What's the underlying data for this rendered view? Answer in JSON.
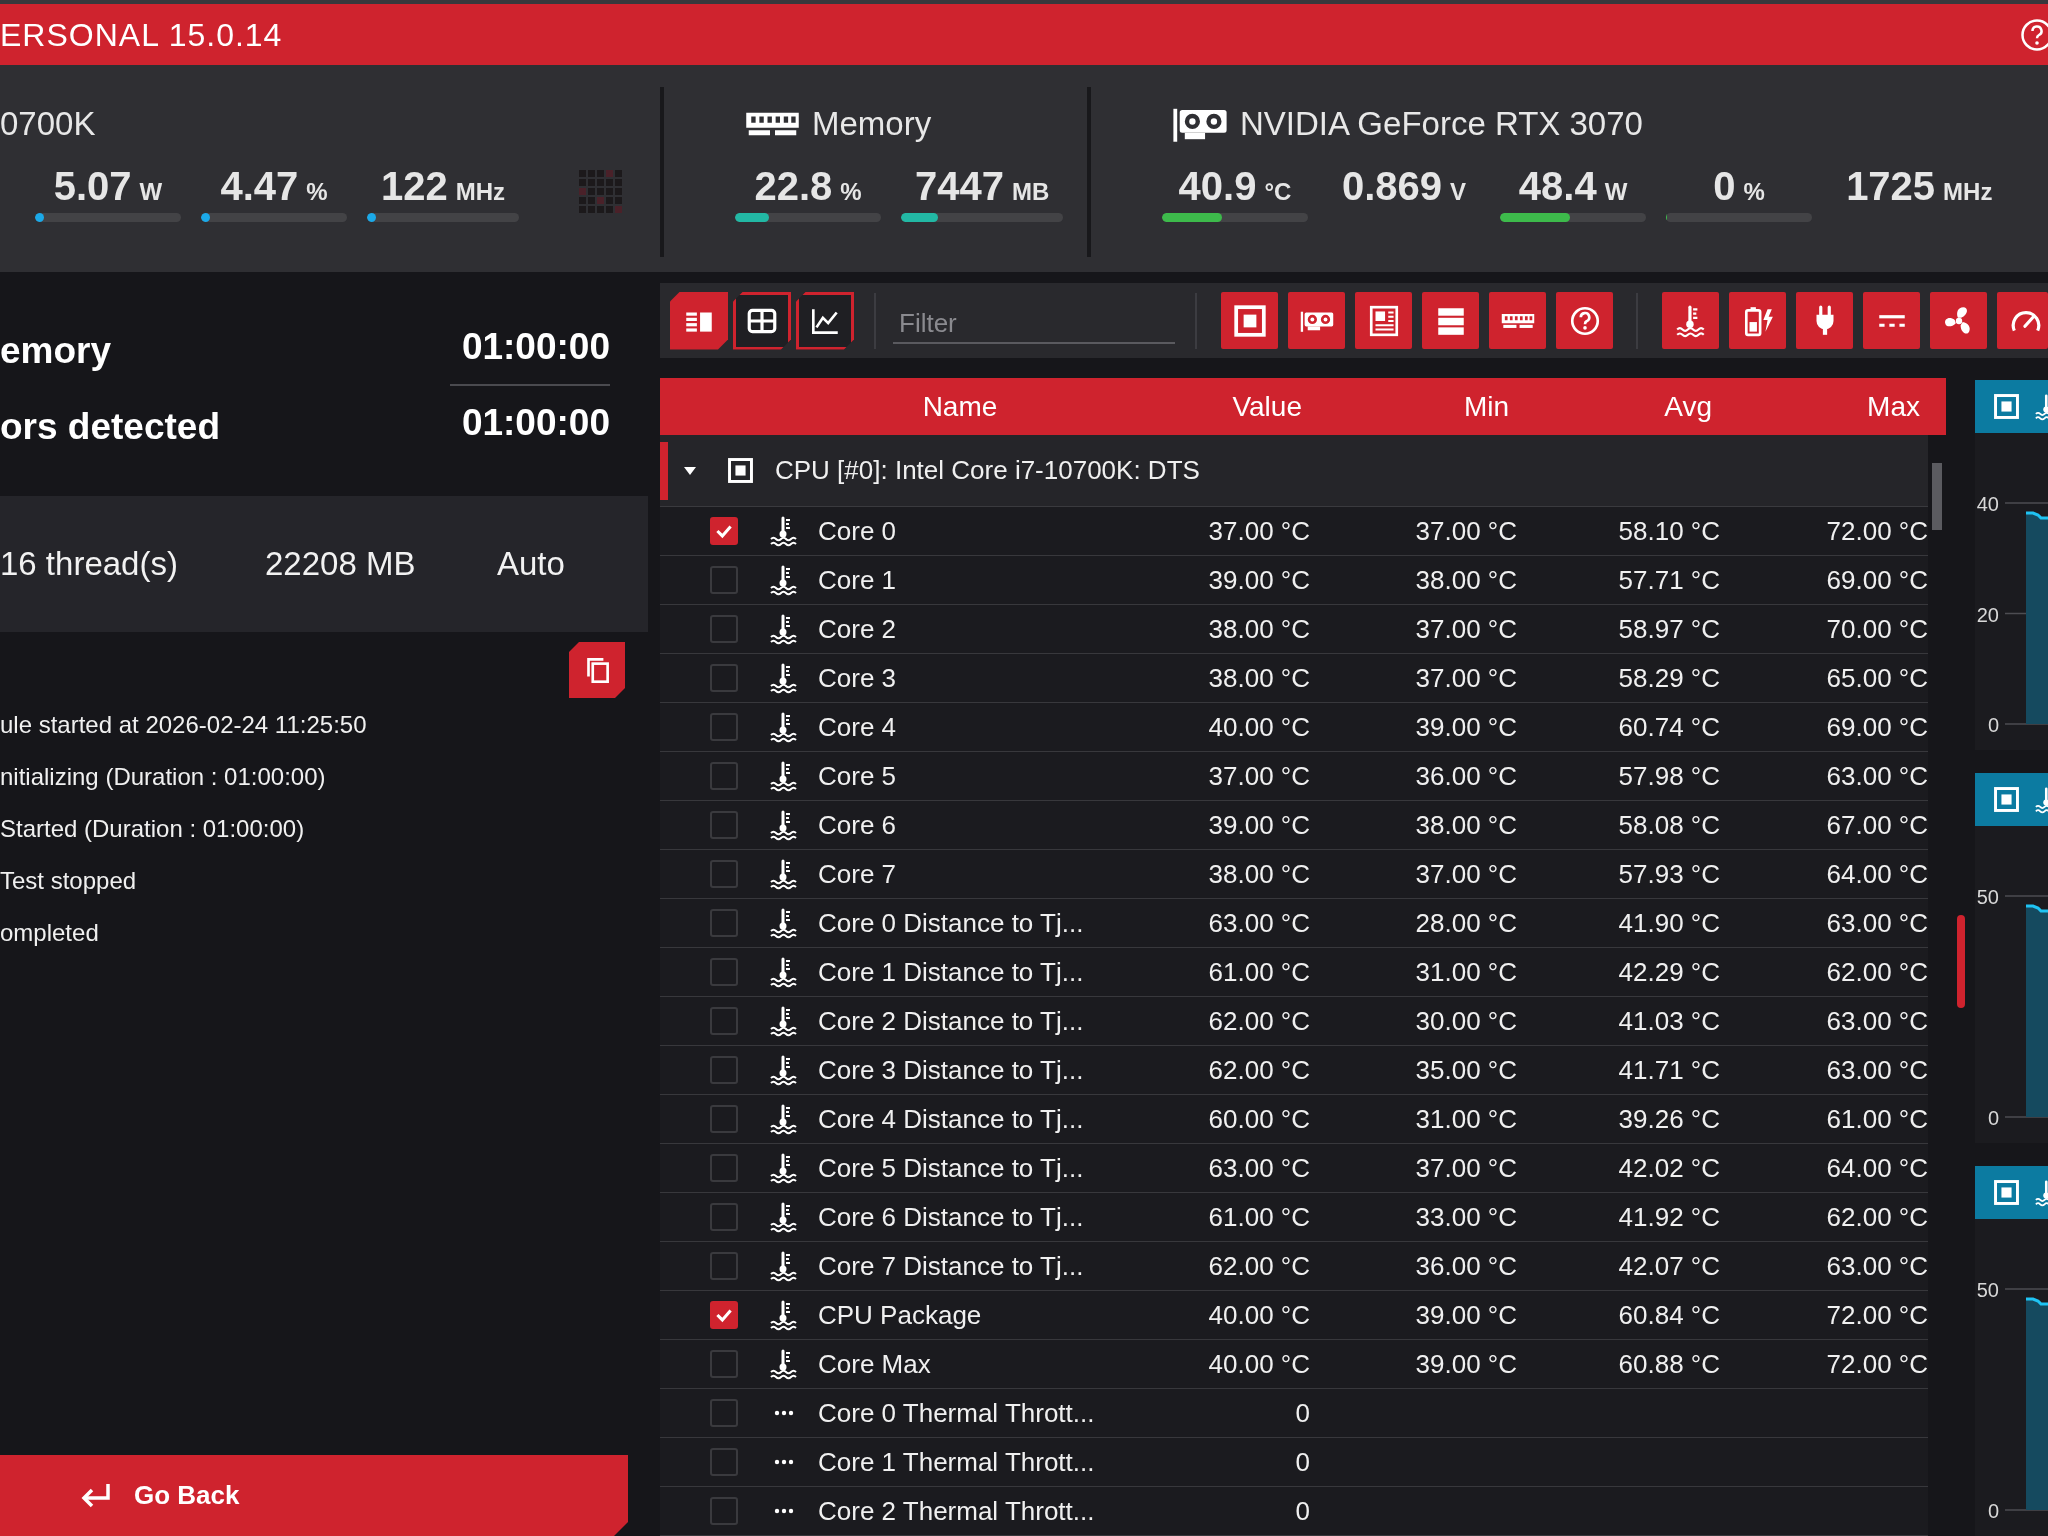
{
  "title_bar": {
    "title": "ERSONAL 15.0.14"
  },
  "hardware": [
    {
      "kind": "cpu",
      "title": "0700K",
      "stats": [
        {
          "value": "5.07",
          "unit": "W",
          "level": 0.03
        },
        {
          "value": "4.47",
          "unit": "%",
          "level": 0.04
        },
        {
          "value": "122",
          "unit": "MHz",
          "level": 0.02
        }
      ]
    },
    {
      "kind": "memory",
      "title": "Memory",
      "stats": [
        {
          "value": "22.8",
          "unit": "%",
          "level": 0.23
        },
        {
          "value": "7447",
          "unit": "MB",
          "level": 0.23
        }
      ]
    },
    {
      "kind": "gpu",
      "title": "NVIDIA GeForce RTX 3070",
      "stats": [
        {
          "value": "40.9",
          "unit": "°C",
          "level": 0.41
        },
        {
          "value": "0.869",
          "unit": "V"
        },
        {
          "value": "48.4",
          "unit": "W",
          "level": 0.48
        },
        {
          "value": "0",
          "unit": "%",
          "level": 0
        },
        {
          "value": "1725",
          "unit": "MHz"
        }
      ]
    }
  ],
  "test_results": [
    {
      "label": "emory",
      "time": "01:00:00"
    },
    {
      "label": "ors detected",
      "time": "01:00:00"
    }
  ],
  "system_info": [
    "16 thread(s)",
    "22208 MB",
    "Auto"
  ],
  "log": [
    "ule started at 2026-02-24 11:25:50",
    "nitializing (Duration : 01:00:00)",
    "Started (Duration : 01:00:00)",
    "Test stopped",
    "ompleted"
  ],
  "go_back": {
    "label": "Go Back"
  },
  "view_buttons": [
    {
      "kind": "list",
      "selected": true
    },
    {
      "kind": "table",
      "selected": false
    },
    {
      "kind": "chart",
      "selected": false
    }
  ],
  "filter": {
    "placeholder": "Filter"
  },
  "device_filters": [
    {
      "kind": "cpu",
      "selected": true
    },
    {
      "kind": "gpu",
      "selected": true
    },
    {
      "kind": "motherboard",
      "selected": true
    },
    {
      "kind": "storage",
      "selected": true
    },
    {
      "kind": "memory",
      "selected": true
    },
    {
      "kind": "other",
      "selected": true
    }
  ],
  "sensor_filters": [
    {
      "kind": "temperature",
      "selected": true
    },
    {
      "kind": "power",
      "selected": true
    },
    {
      "kind": "plug",
      "selected": true
    },
    {
      "kind": "dc",
      "selected": true
    },
    {
      "kind": "fan",
      "selected": true
    },
    {
      "kind": "gauge",
      "selected": true
    }
  ],
  "table": {
    "columns": [
      "Name",
      "Value",
      "Min",
      "Avg",
      "Max"
    ],
    "groups": [
      {
        "kind": "cpu",
        "name": "CPU [#0]: Intel Core i7-10700K: DTS",
        "expanded": true,
        "selected": true,
        "rows": [
          {
            "kind": "temperature",
            "checked": true,
            "name": "Core 0",
            "value": "37.00 °C",
            "min": "37.00 °C",
            "avg": "58.10 °C",
            "max": "72.00 °C"
          },
          {
            "kind": "temperature",
            "checked": false,
            "name": "Core 1",
            "value": "39.00 °C",
            "min": "38.00 °C",
            "avg": "57.71 °C",
            "max": "69.00 °C"
          },
          {
            "kind": "temperature",
            "checked": false,
            "name": "Core 2",
            "value": "38.00 °C",
            "min": "37.00 °C",
            "avg": "58.97 °C",
            "max": "70.00 °C"
          },
          {
            "kind": "temperature",
            "checked": false,
            "name": "Core 3",
            "value": "38.00 °C",
            "min": "37.00 °C",
            "avg": "58.29 °C",
            "max": "65.00 °C"
          },
          {
            "kind": "temperature",
            "checked": false,
            "name": "Core 4",
            "value": "40.00 °C",
            "min": "39.00 °C",
            "avg": "60.74 °C",
            "max": "69.00 °C"
          },
          {
            "kind": "temperature",
            "checked": false,
            "name": "Core 5",
            "value": "37.00 °C",
            "min": "36.00 °C",
            "avg": "57.98 °C",
            "max": "63.00 °C"
          },
          {
            "kind": "temperature",
            "checked": false,
            "name": "Core 6",
            "value": "39.00 °C",
            "min": "38.00 °C",
            "avg": "58.08 °C",
            "max": "67.00 °C"
          },
          {
            "kind": "temperature",
            "checked": false,
            "name": "Core 7",
            "value": "38.00 °C",
            "min": "37.00 °C",
            "avg": "57.93 °C",
            "max": "64.00 °C"
          },
          {
            "kind": "temperature",
            "checked": false,
            "name": "Core 0 Distance to Tj...",
            "value": "63.00 °C",
            "min": "28.00 °C",
            "avg": "41.90 °C",
            "max": "63.00 °C"
          },
          {
            "kind": "temperature",
            "checked": false,
            "name": "Core 1 Distance to Tj...",
            "value": "61.00 °C",
            "min": "31.00 °C",
            "avg": "42.29 °C",
            "max": "62.00 °C"
          },
          {
            "kind": "temperature",
            "checked": false,
            "name": "Core 2 Distance to Tj...",
            "value": "62.00 °C",
            "min": "30.00 °C",
            "avg": "41.03 °C",
            "max": "63.00 °C"
          },
          {
            "kind": "temperature",
            "checked": false,
            "name": "Core 3 Distance to Tj...",
            "value": "62.00 °C",
            "min": "35.00 °C",
            "avg": "41.71 °C",
            "max": "63.00 °C"
          },
          {
            "kind": "temperature",
            "checked": false,
            "name": "Core 4 Distance to Tj...",
            "value": "60.00 °C",
            "min": "31.00 °C",
            "avg": "39.26 °C",
            "max": "61.00 °C"
          },
          {
            "kind": "temperature",
            "checked": false,
            "name": "Core 5 Distance to Tj...",
            "value": "63.00 °C",
            "min": "37.00 °C",
            "avg": "42.02 °C",
            "max": "64.00 °C"
          },
          {
            "kind": "temperature",
            "checked": false,
            "name": "Core 6 Distance to Tj...",
            "value": "61.00 °C",
            "min": "33.00 °C",
            "avg": "41.92 °C",
            "max": "62.00 °C"
          },
          {
            "kind": "temperature",
            "checked": false,
            "name": "Core 7 Distance to Tj...",
            "value": "62.00 °C",
            "min": "36.00 °C",
            "avg": "42.07 °C",
            "max": "63.00 °C"
          },
          {
            "kind": "temperature",
            "checked": true,
            "name": "CPU Package",
            "value": "40.00 °C",
            "min": "39.00 °C",
            "avg": "60.84 °C",
            "max": "72.00 °C"
          },
          {
            "kind": "temperature",
            "checked": false,
            "name": "Core Max",
            "value": "40.00 °C",
            "min": "39.00 °C",
            "avg": "60.88 °C",
            "max": "72.00 °C"
          },
          {
            "kind": "other",
            "checked": false,
            "name": "Core 0 Thermal Thrott...",
            "value": "0"
          },
          {
            "kind": "other",
            "checked": false,
            "name": "Core 1 Thermal Thrott...",
            "value": "0"
          },
          {
            "kind": "other",
            "checked": false,
            "name": "Core 2 Thermal Thrott...",
            "value": "0"
          }
        ]
      }
    ]
  },
  "history_graphs": [
    {
      "axis_labels": [
        "40",
        "20",
        "0"
      ]
    },
    {
      "axis_labels": [
        "50",
        "0"
      ]
    },
    {
      "axis_labels": [
        "50",
        "0"
      ]
    }
  ]
}
